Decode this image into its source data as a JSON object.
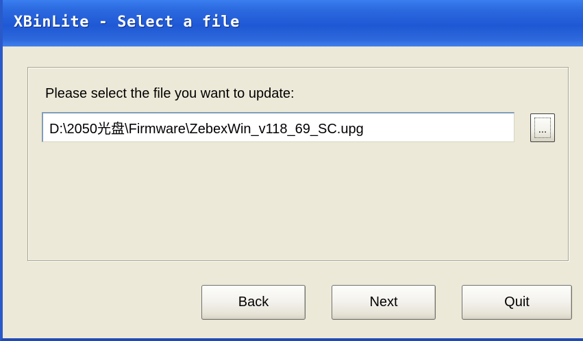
{
  "window": {
    "title": "XBinLite - Select a file",
    "title_bar_color": "#2c6ae0",
    "background_color": "#ece9d8"
  },
  "form": {
    "prompt": "Please select the file you want to update:",
    "file_path": "D:\\2050光盘\\Firmware\\ZebexWin_v118_69_SC.upg",
    "browse_label": "..."
  },
  "buttons": {
    "back": "Back",
    "next": "Next",
    "quit": "Quit"
  }
}
